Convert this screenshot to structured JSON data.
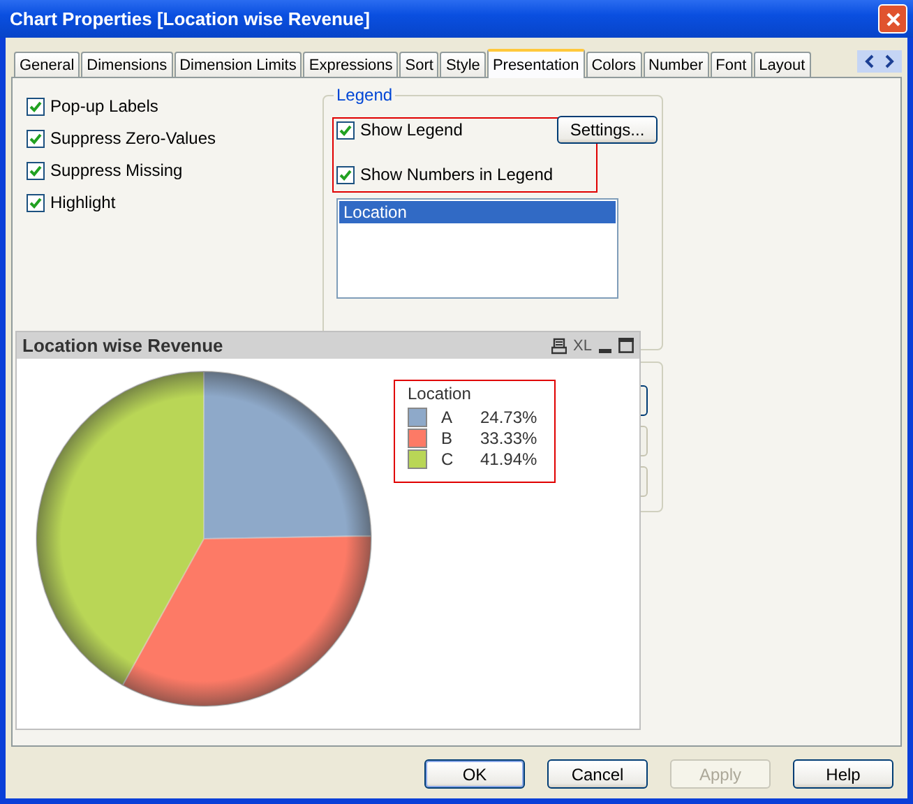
{
  "window": {
    "title": "Chart Properties [Location wise Revenue]"
  },
  "tabs": [
    {
      "label": "General",
      "selected": false
    },
    {
      "label": "Dimensions",
      "selected": false
    },
    {
      "label": "Dimension Limits",
      "selected": false
    },
    {
      "label": "Expressions",
      "selected": false
    },
    {
      "label": "Sort",
      "selected": false
    },
    {
      "label": "Style",
      "selected": false
    },
    {
      "label": "Presentation",
      "selected": true
    },
    {
      "label": "Colors",
      "selected": false
    },
    {
      "label": "Number",
      "selected": false
    },
    {
      "label": "Font",
      "selected": false
    },
    {
      "label": "Layout",
      "selected": false
    }
  ],
  "options": [
    {
      "label": "Pop-up Labels",
      "checked": true
    },
    {
      "label": "Suppress Zero-Values",
      "checked": true
    },
    {
      "label": "Suppress Missing",
      "checked": true
    },
    {
      "label": "Highlight",
      "checked": true
    }
  ],
  "legend_group": {
    "title": "Legend",
    "highlighted": true,
    "show_legend": {
      "label": "Show Legend",
      "checked": true
    },
    "settings_button": "Settings...",
    "show_numbers": {
      "label": "Show Numbers in Legend",
      "checked": true
    },
    "list_items": [
      {
        "label": "Location",
        "selected": true
      }
    ]
  },
  "chart_window": {
    "title": "Location wise Revenue",
    "xl_label": "XL",
    "legend_title": "Location",
    "legend_highlighted": true,
    "legend": [
      {
        "value": "24.73%",
        "color": "#8ea9c9"
      },
      {
        "value": "33.33%",
        "color": "#fd7a66"
      },
      {
        "value": "41.94%",
        "color": "#b9d656"
      }
    ],
    "chart_data": {
      "type": "pie",
      "categories": [
        "A",
        "B",
        "C"
      ],
      "values": [
        24.73,
        33.33,
        41.94
      ]
    }
  },
  "buttons": [
    {
      "label": "OK",
      "disabled": false
    },
    {
      "label": "Cancel",
      "disabled": false
    },
    {
      "label": "Apply",
      "disabled": true
    },
    {
      "label": "Help",
      "disabled": false
    }
  ]
}
